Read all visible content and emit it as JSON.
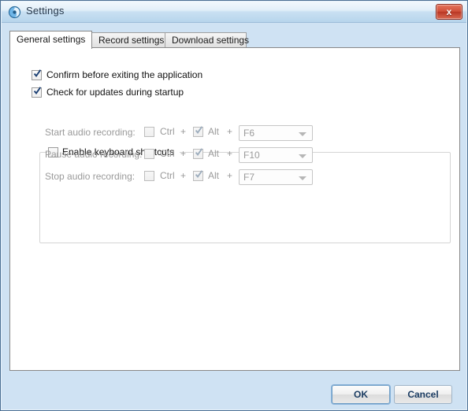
{
  "window": {
    "title": "Settings",
    "icon": "app-swirl-icon",
    "close_label": "x",
    "accent_color": "#b7d5ec",
    "close_color": "#c6442c"
  },
  "tabs": [
    {
      "label": "General settings",
      "active": true
    },
    {
      "label": "Record settings",
      "active": false
    },
    {
      "label": "Download settings",
      "active": false
    }
  ],
  "general": {
    "options": [
      {
        "label": "Confirm before exiting the application",
        "checked": true
      },
      {
        "label": "Check for updates during startup",
        "checked": true
      }
    ],
    "shortcuts_group": {
      "title": "Enable keyboard shortcuts",
      "checked": false,
      "enabled": false,
      "modifier_separator": "+",
      "rows": [
        {
          "label": "Start audio recording:",
          "ctrl_label": "Ctrl",
          "ctrl_checked": false,
          "alt_label": "Alt",
          "alt_checked": true,
          "key": "F6"
        },
        {
          "label": "Pause audio recording:",
          "ctrl_label": "Ctrl",
          "ctrl_checked": false,
          "alt_label": "Alt",
          "alt_checked": true,
          "key": "F10"
        },
        {
          "label": "Stop audio recording:",
          "ctrl_label": "Ctrl",
          "ctrl_checked": false,
          "alt_label": "Alt",
          "alt_checked": true,
          "key": "F7"
        }
      ]
    }
  },
  "footer": {
    "ok_label": "OK",
    "cancel_label": "Cancel",
    "focused_button": "OK"
  }
}
